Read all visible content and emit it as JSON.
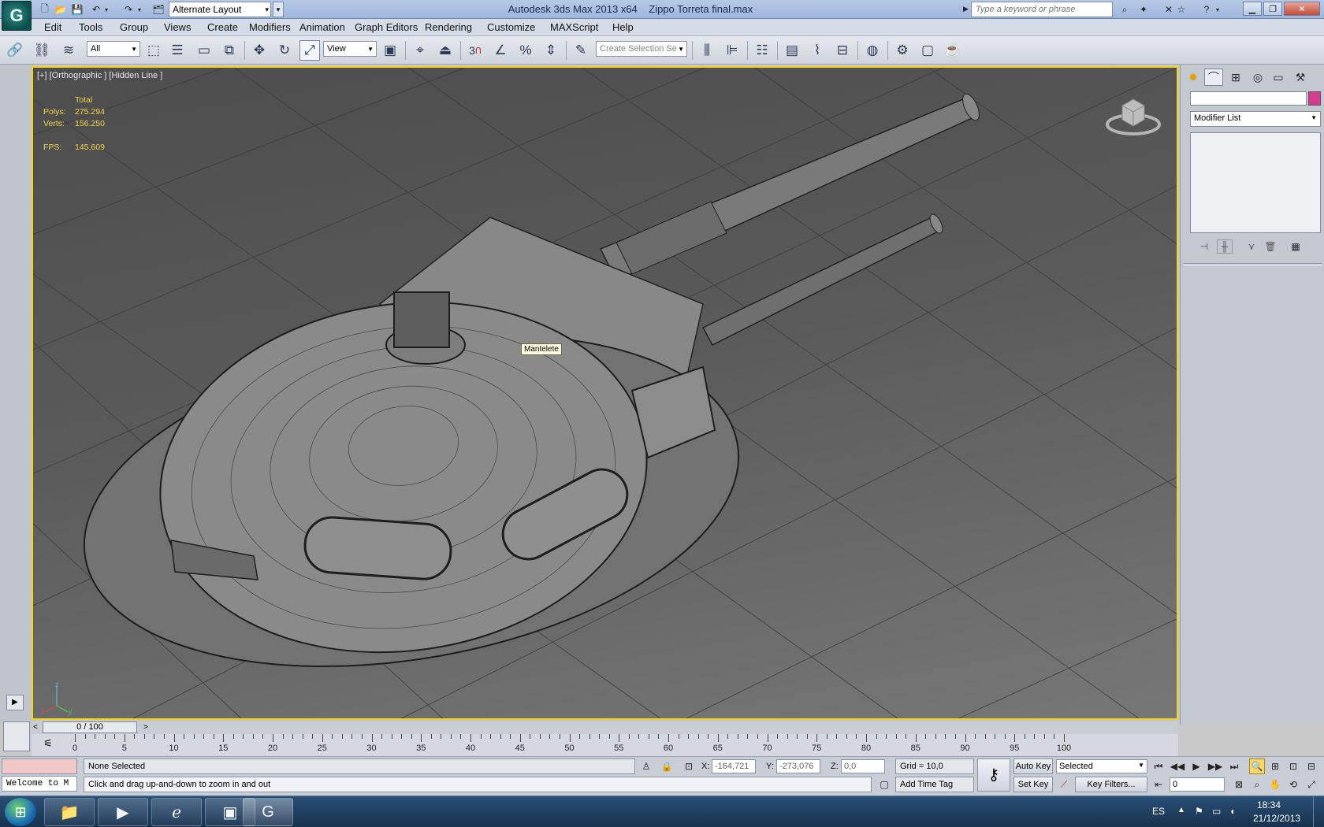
{
  "window": {
    "app_title": "Autodesk 3ds Max  2013 x64",
    "file_title": "Zippo Torreta final.max",
    "workspace": "Alternate Layout",
    "search_placeholder": "Type a keyword or phrase"
  },
  "menu": [
    "Edit",
    "Tools",
    "Group",
    "Views",
    "Create",
    "Modifiers",
    "Animation",
    "Graph Editors",
    "Rendering",
    "Customize",
    "MAXScript",
    "Help"
  ],
  "toolbar": {
    "selection_filter": "All",
    "reference_coord": "View",
    "named_selection_placeholder": "Create Selection Se",
    "snap_label": "3"
  },
  "viewport": {
    "label": "[+] [Orthographic ] [Hidden Line ]",
    "stats": {
      "header": "Total",
      "polys_label": "Polys:",
      "polys": "275.294",
      "verts_label": "Verts:",
      "verts": "156.250",
      "fps_label": "FPS:",
      "fps": "145,609"
    },
    "tooltip": "Mantelete",
    "axis": {
      "x": "x",
      "y": "y",
      "z": "z"
    },
    "border_color": "#f2d21a"
  },
  "command_panel": {
    "modifier_list": "Modifier List",
    "object_color": "#d63a8c"
  },
  "timeline": {
    "slider": "0 / 100",
    "ticks": [
      0,
      5,
      10,
      15,
      20,
      25,
      30,
      35,
      40,
      45,
      50,
      55,
      60,
      65,
      70,
      75,
      80,
      85,
      90,
      95,
      100
    ]
  },
  "status": {
    "maxscript_listener": "Welcome to M",
    "selection": "None Selected",
    "prompt": "Click and drag up-and-down to zoom in and out",
    "x_label": "X:",
    "x": "-164,721",
    "y_label": "Y:",
    "y": "-273,076",
    "z_label": "Z:",
    "z": "0,0",
    "grid": "Grid = 10,0",
    "add_time_tag": "Add Time Tag",
    "auto_key": "Auto Key",
    "set_key": "Set Key",
    "key_mode": "Selected",
    "key_filters": "Key Filters...",
    "current_frame": "0"
  },
  "taskbar": {
    "language": "ES",
    "time": "18:34",
    "date": "21/12/2013"
  }
}
